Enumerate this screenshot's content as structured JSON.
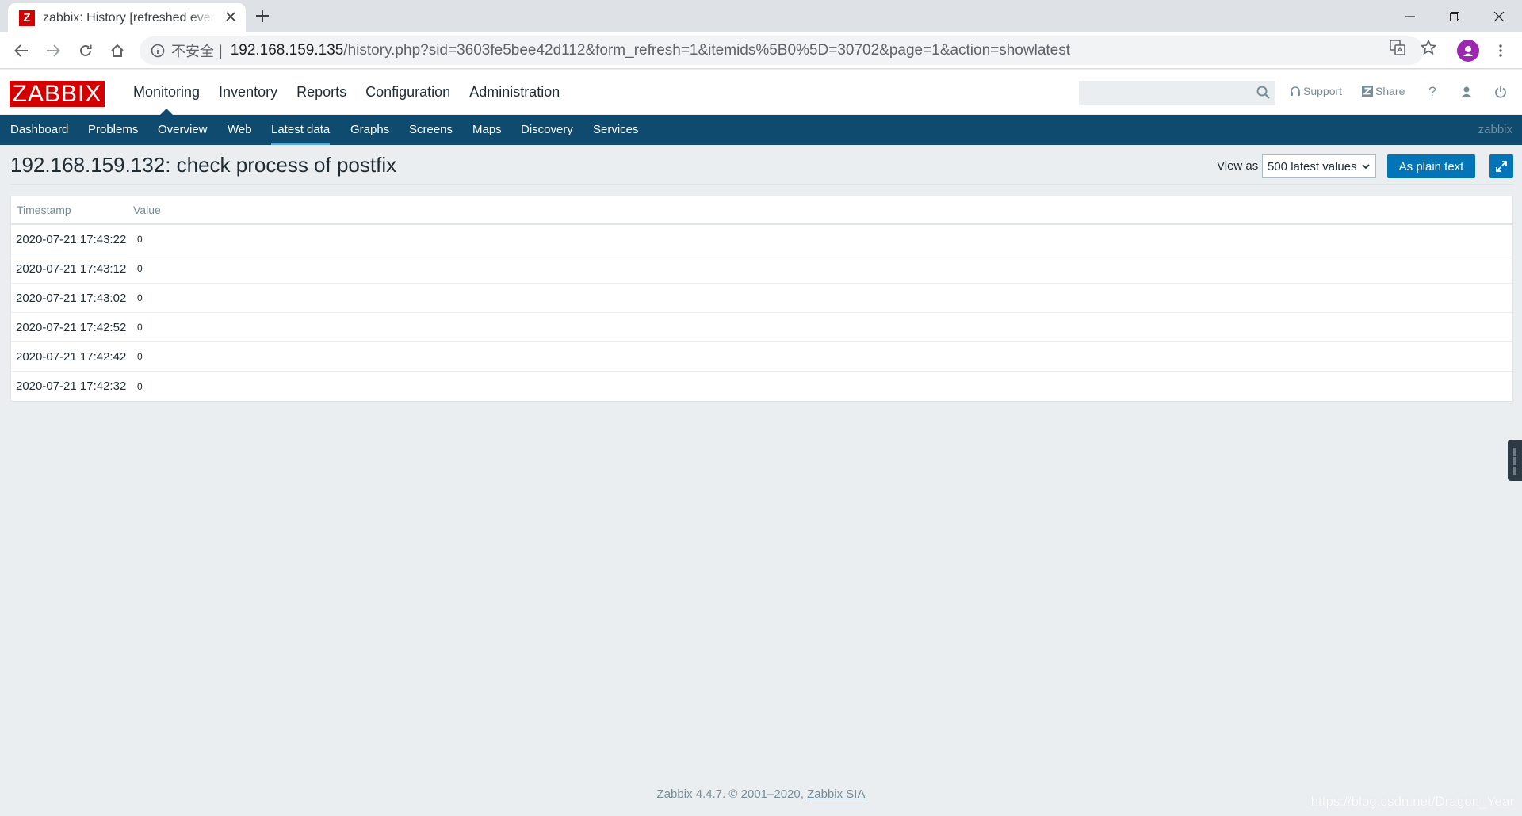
{
  "browser": {
    "tab_title": "zabbix: History [refreshed every",
    "tab_favicon_letter": "Z",
    "security_label": "不安全",
    "url_host": "192.168.159.135",
    "url_path": "/history.php?sid=3603fe5bee42d112&form_refresh=1&itemids%5B0%5D=30702&page=1&action=showlatest"
  },
  "header": {
    "logo": "ZABBIX",
    "menu": [
      {
        "label": "Monitoring",
        "active": true
      },
      {
        "label": "Inventory"
      },
      {
        "label": "Reports"
      },
      {
        "label": "Configuration"
      },
      {
        "label": "Administration"
      }
    ],
    "search_placeholder": "",
    "support_label": "Support",
    "share_label": "Share",
    "help_label": "?"
  },
  "subnav": {
    "items": [
      {
        "label": "Dashboard"
      },
      {
        "label": "Problems"
      },
      {
        "label": "Overview"
      },
      {
        "label": "Web"
      },
      {
        "label": "Latest data",
        "active": true
      },
      {
        "label": "Graphs"
      },
      {
        "label": "Screens"
      },
      {
        "label": "Maps"
      },
      {
        "label": "Discovery"
      },
      {
        "label": "Services"
      }
    ],
    "server_name": "zabbix"
  },
  "page": {
    "title": "192.168.159.132: check process of postfix",
    "view_as_label": "View as",
    "view_as_selected": "500 latest values",
    "plain_text_button": "As plain text"
  },
  "table": {
    "columns": [
      "Timestamp",
      "Value"
    ],
    "rows": [
      {
        "timestamp": "2020-07-21 17:43:22",
        "value": "0"
      },
      {
        "timestamp": "2020-07-21 17:43:12",
        "value": "0"
      },
      {
        "timestamp": "2020-07-21 17:43:02",
        "value": "0"
      },
      {
        "timestamp": "2020-07-21 17:42:52",
        "value": "0"
      },
      {
        "timestamp": "2020-07-21 17:42:42",
        "value": "0"
      },
      {
        "timestamp": "2020-07-21 17:42:32",
        "value": "0"
      }
    ]
  },
  "footer": {
    "text": "Zabbix 4.4.7. © 2001–2020,",
    "link": "Zabbix SIA"
  },
  "watermark": "https://blog.csdn.net/Dragon_Year",
  "colors": {
    "brand_red": "#d40000",
    "subnav_bg": "#0e4b6e",
    "primary_button": "#0275b8",
    "page_bg": "#ebeef0"
  }
}
